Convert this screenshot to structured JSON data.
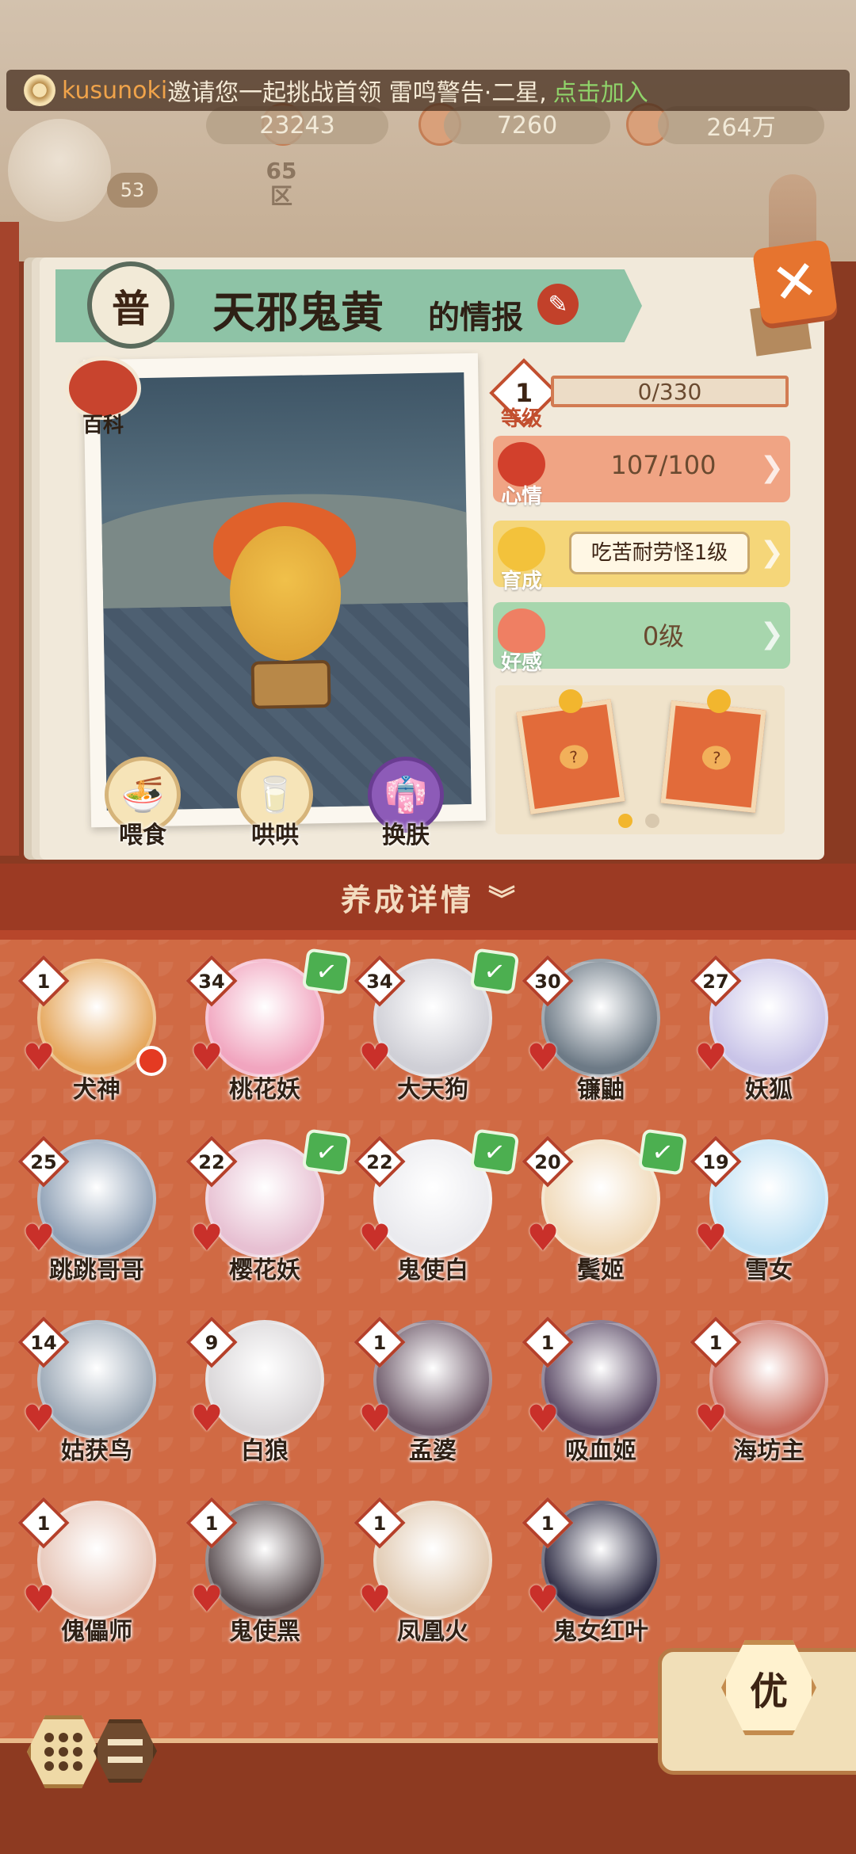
{
  "top": {
    "invite_user": "kusunoki",
    "invite_text": "邀请您一起挑战首领 雷鸣警告·二星,",
    "invite_join": "点击加入",
    "currencies": [
      "23243",
      "7260",
      "264万"
    ],
    "player_level": "53",
    "zone_number": "65",
    "zone_label": "区"
  },
  "info": {
    "rarity": "普",
    "name": "天邪鬼黄",
    "suffix": "的情报",
    "baike_label": "百科",
    "level_label": "等级",
    "level_value": "1",
    "xp": "0/330",
    "mood_label": "心情",
    "mood_value": "107/100",
    "grow_label": "育成",
    "grow_value": "吃苦耐劳怪1级",
    "favor_label": "好感",
    "favor_value": "0级",
    "feed_label": "喂食",
    "coax_label": "哄哄",
    "skin_label": "换肤",
    "card_question": "?"
  },
  "detail_header": "养成详情",
  "icons": {
    "close": "close-icon",
    "edit": "edit-icon",
    "chevron": "chevron-down-icon",
    "heart": "heart-icon",
    "check": "check-icon"
  },
  "shikigami": [
    {
      "level": "1",
      "name": "犬神",
      "checked": false,
      "color": "#e5a65a"
    },
    {
      "level": "34",
      "name": "桃花妖",
      "checked": true,
      "color": "#f1a5bf"
    },
    {
      "level": "34",
      "name": "大天狗",
      "checked": true,
      "color": "#cfcfd6"
    },
    {
      "level": "30",
      "name": "镰鼬",
      "checked": false,
      "color": "#6d7a86"
    },
    {
      "level": "27",
      "name": "妖狐",
      "checked": false,
      "color": "#c9c4e8"
    },
    {
      "level": "25",
      "name": "跳跳哥哥",
      "checked": false,
      "color": "#8ea0b5"
    },
    {
      "level": "22",
      "name": "樱花妖",
      "checked": true,
      "color": "#e7c0d2"
    },
    {
      "level": "22",
      "name": "鬼使白",
      "checked": true,
      "color": "#eaeaee"
    },
    {
      "level": "20",
      "name": "鬓姬",
      "checked": true,
      "color": "#f0d9b8"
    },
    {
      "level": "19",
      "name": "雪女",
      "checked": false,
      "color": "#bfe1f4"
    },
    {
      "level": "14",
      "name": "姑获鸟",
      "checked": false,
      "color": "#9aa7b5"
    },
    {
      "level": "9",
      "name": "白狼",
      "checked": false,
      "color": "#d9d6d8"
    },
    {
      "level": "1",
      "name": "孟婆",
      "checked": false,
      "color": "#6e5a6a"
    },
    {
      "level": "1",
      "name": "吸血姬",
      "checked": false,
      "color": "#5b4a66"
    },
    {
      "level": "1",
      "name": "海坊主",
      "checked": false,
      "color": "#c96b5c"
    },
    {
      "level": "1",
      "name": "傀儡师",
      "checked": false,
      "color": "#e7c6b8"
    },
    {
      "level": "1",
      "name": "鬼使黑",
      "checked": false,
      "color": "#5b4f52"
    },
    {
      "level": "1",
      "name": "凤凰火",
      "checked": false,
      "color": "#e0c9b0"
    },
    {
      "level": "1",
      "name": "鬼女红叶",
      "checked": false,
      "color": "#2f2d45"
    }
  ],
  "bottom": {
    "you_label": "优"
  },
  "colors": {
    "accent": "#9c3a23",
    "grid_bg": "#d06a44",
    "mood": "#f0a484",
    "grow": "#f5d679",
    "favor": "#a7d6ad"
  }
}
